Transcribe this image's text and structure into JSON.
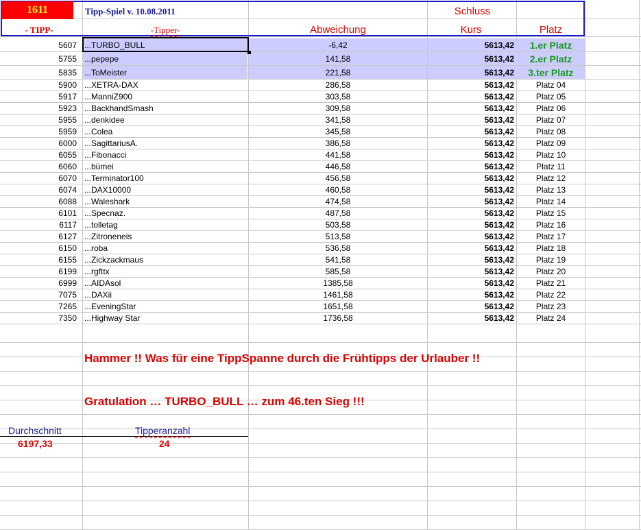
{
  "header": {
    "number": "1611",
    "title": "Tipp-Spiel v. 10.08.2011",
    "schluss": "Schluss",
    "col_tipp": "- TIPP-",
    "col_tipper": "-Tipper-",
    "col_abweichung": "Abweichung",
    "col_kurs": "Kurs",
    "col_platz": "Platz"
  },
  "rows": [
    {
      "tipp": "5607",
      "name": "...TURBO_BULL",
      "abw": "-6,42",
      "kurs": "5613,42",
      "platz": "1.er Platz"
    },
    {
      "tipp": "5755",
      "name": "...pepepe",
      "abw": "141,58",
      "kurs": "5613,42",
      "platz": "2.er Platz"
    },
    {
      "tipp": "5835",
      "name": "...ToMeister",
      "abw": "221,58",
      "kurs": "5613,42",
      "platz": "3.ter Platz"
    },
    {
      "tipp": "5900",
      "name": "...XETRA-DAX",
      "abw": "286,58",
      "kurs": "5613,42",
      "platz": "Platz 04"
    },
    {
      "tipp": "5917",
      "name": "...ManniZ900",
      "abw": "303,58",
      "kurs": "5613,42",
      "platz": "Platz 05"
    },
    {
      "tipp": "5923",
      "name": "...BackhandSmash",
      "abw": "309,58",
      "kurs": "5613,42",
      "platz": "Platz 06"
    },
    {
      "tipp": "5955",
      "name": "...denkidee",
      "abw": "341,58",
      "kurs": "5613,42",
      "platz": "Platz 07"
    },
    {
      "tipp": "5959",
      "name": "...Colea",
      "abw": "345,58",
      "kurs": "5613,42",
      "platz": "Platz 08"
    },
    {
      "tipp": "6000",
      "name": "...SagittariusA.",
      "abw": "386,58",
      "kurs": "5613,42",
      "platz": "Platz 09"
    },
    {
      "tipp": "6055",
      "name": "...Fibonacci",
      "abw": "441,58",
      "kurs": "5613,42",
      "platz": "Platz 10"
    },
    {
      "tipp": "6060",
      "name": "...bümei",
      "abw": "446,58",
      "kurs": "5613,42",
      "platz": "Platz 11"
    },
    {
      "tipp": "6070",
      "name": "...Terminator100",
      "abw": "456,58",
      "kurs": "5613,42",
      "platz": "Platz 12"
    },
    {
      "tipp": "6074",
      "name": "...DAX10000",
      "abw": "460,58",
      "kurs": "5613,42",
      "platz": "Platz 13"
    },
    {
      "tipp": "6088",
      "name": "...Waleshark",
      "abw": "474,58",
      "kurs": "5613,42",
      "platz": "Platz 14"
    },
    {
      "tipp": "6101",
      "name": "...Specnaz.",
      "abw": "487,58",
      "kurs": "5613,42",
      "platz": "Platz 15"
    },
    {
      "tipp": "6117",
      "name": "...tolletag",
      "abw": "503,58",
      "kurs": "5613,42",
      "platz": "Platz 16"
    },
    {
      "tipp": "6127",
      "name": "...Zitroneneis",
      "abw": "513,58",
      "kurs": "5613,42",
      "platz": "Platz 17"
    },
    {
      "tipp": "6150",
      "name": "...roba",
      "abw": "536,58",
      "kurs": "5613,42",
      "platz": "Platz 18"
    },
    {
      "tipp": "6155",
      "name": "...Zickzackmaus",
      "abw": "541,58",
      "kurs": "5613,42",
      "platz": "Platz 19"
    },
    {
      "tipp": "6199",
      "name": "...rgfttx",
      "abw": "585,58",
      "kurs": "5613,42",
      "platz": "Platz 20"
    },
    {
      "tipp": "6999",
      "name": "...AIDAsol",
      "abw": "1385,58",
      "kurs": "5613,42",
      "platz": "Platz 21"
    },
    {
      "tipp": "7075",
      "name": "...DAXii",
      "abw": "1461,58",
      "kurs": "5613,42",
      "platz": "Platz 22"
    },
    {
      "tipp": "7265",
      "name": "...EveningStar",
      "abw": "1651,58",
      "kurs": "5613,42",
      "platz": "Platz 23"
    },
    {
      "tipp": "7350",
      "name": "...Highway Star",
      "abw": "1736,58",
      "kurs": "5613,42",
      "platz": "Platz 24"
    }
  ],
  "messages": {
    "hammer": "Hammer !! Was für eine TippSpanne durch die Frühtipps der Urlauber !!",
    "gratulation": "Gratulation … TURBO_BULL … zum   46.ten   Sieg !!!"
  },
  "stats": {
    "durchschnitt_label": "Durchschnitt",
    "durchschnitt_value": "6197,33",
    "tipperanzahl_label": "Tipperanzahl",
    "tipperanzahl_value": "24"
  },
  "colors": {
    "accent_red": "#e00000",
    "header_blue": "#1a1acc",
    "highlight": "#ccccff",
    "winner_green": "#1a9a1a"
  }
}
